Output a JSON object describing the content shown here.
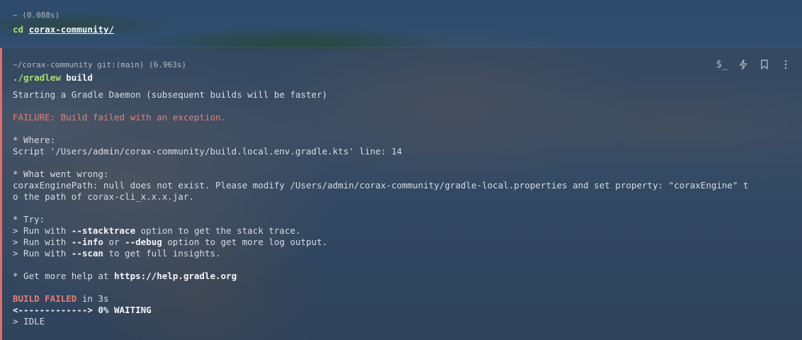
{
  "prev_block": {
    "meta": "~ (0.088s)",
    "cmd_bin": "cd",
    "cmd_arg": "corax-community/"
  },
  "active_block": {
    "meta": "~/corax-community git:(main) (6.963s)",
    "cmd_bin": "./gradlew",
    "cmd_arg": "build",
    "toolbar": {
      "workflows_icon": "dollar-prompt-icon",
      "workflows_label": "$_",
      "ai_icon": "lightning-icon",
      "bookmark_icon": "bookmark-icon",
      "more_icon": "kebab-menu-icon"
    },
    "output": {
      "daemon": "Starting a Gradle Daemon (subsequent builds will be faster)",
      "failure": "FAILURE: Build failed with an exception.",
      "where_header": "* Where:",
      "where_detail": "Script '/Users/admin/corax-community/build.local.env.gradle.kts' line: 14",
      "wrong_header": "* What went wrong:",
      "wrong_line1": "coraxEnginePath: null does not exist. Please modify /Users/admin/corax-community/gradle-local.properties and set property: \"coraxEngine\" t",
      "wrong_line2": "o the path of corax-cli_x.x.x.jar.",
      "try_header": "* Try:",
      "try1_pre": "> Run with ",
      "try1_flag": "--stacktrace",
      "try1_post": " option to get the stack trace.",
      "try2_pre": "> Run with ",
      "try2_flag1": "--info",
      "try2_mid": " or ",
      "try2_flag2": "--debug",
      "try2_post": " option to get more log output.",
      "try3_pre": "> Run with ",
      "try3_flag": "--scan",
      "try3_post": " to get full insights.",
      "help_pre": "* Get more help at ",
      "help_url": "https://help.gradle.org",
      "build_failed": "BUILD FAILED",
      "build_time": " in 3s",
      "progress": "<-------------> 0% WAITING",
      "idle": "> IDLE"
    }
  }
}
